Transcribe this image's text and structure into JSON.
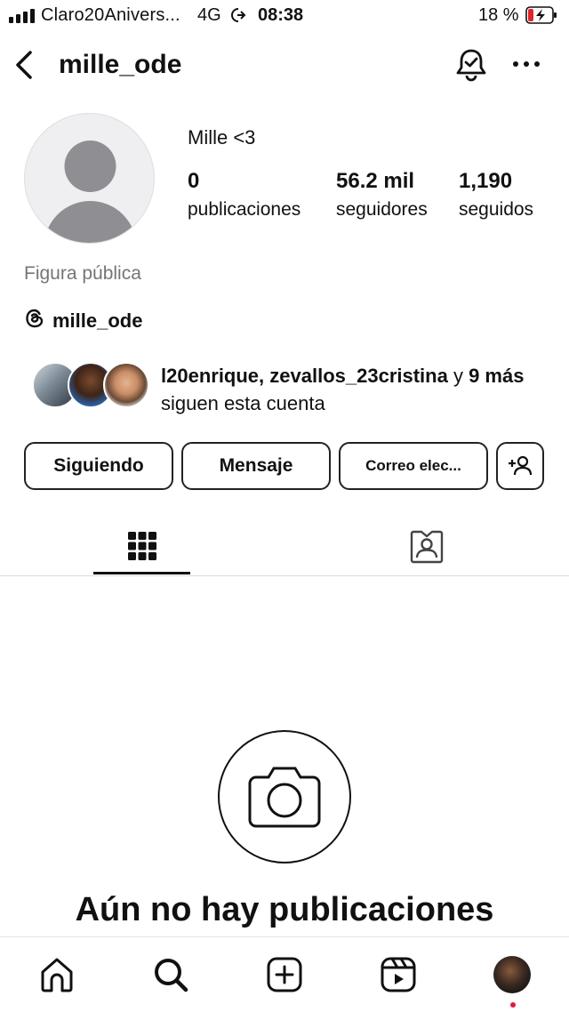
{
  "status_bar": {
    "carrier": "Claro20Anivers...",
    "network": "4G",
    "time": "08:38",
    "battery_text": "18 %"
  },
  "header": {
    "username": "mille_ode"
  },
  "profile": {
    "display_name": "Mille <3",
    "stats": [
      {
        "value": "0",
        "label": "publicaciones"
      },
      {
        "value": "56.2 mil",
        "label": "seguidores"
      },
      {
        "value": "1,190",
        "label": "seguidos"
      }
    ],
    "category": "Figura pública",
    "threads_handle": "mille_ode",
    "followed_by": {
      "names": "l20enrique, zevallos_23cristina",
      "connector": " y ",
      "more": "9 más",
      "suffix": " siguen esta cuenta"
    }
  },
  "actions": {
    "following_label": "Siguiendo",
    "message_label": "Mensaje",
    "email_label": "Correo elec..."
  },
  "tabs": [
    {
      "icon": "grid-icon",
      "active": true
    },
    {
      "icon": "tagged-icon",
      "active": false
    }
  ],
  "empty_state": {
    "title": "Aún no hay publicaciones"
  },
  "bottom_nav": [
    "home-icon",
    "search-icon",
    "create-icon",
    "reels-icon",
    "profile-avatar"
  ],
  "colors": {
    "text": "#111111",
    "muted": "#757575",
    "divider": "#dbdbdb",
    "notification_dot": "#e4193b",
    "battery_low": "#e0262b"
  }
}
